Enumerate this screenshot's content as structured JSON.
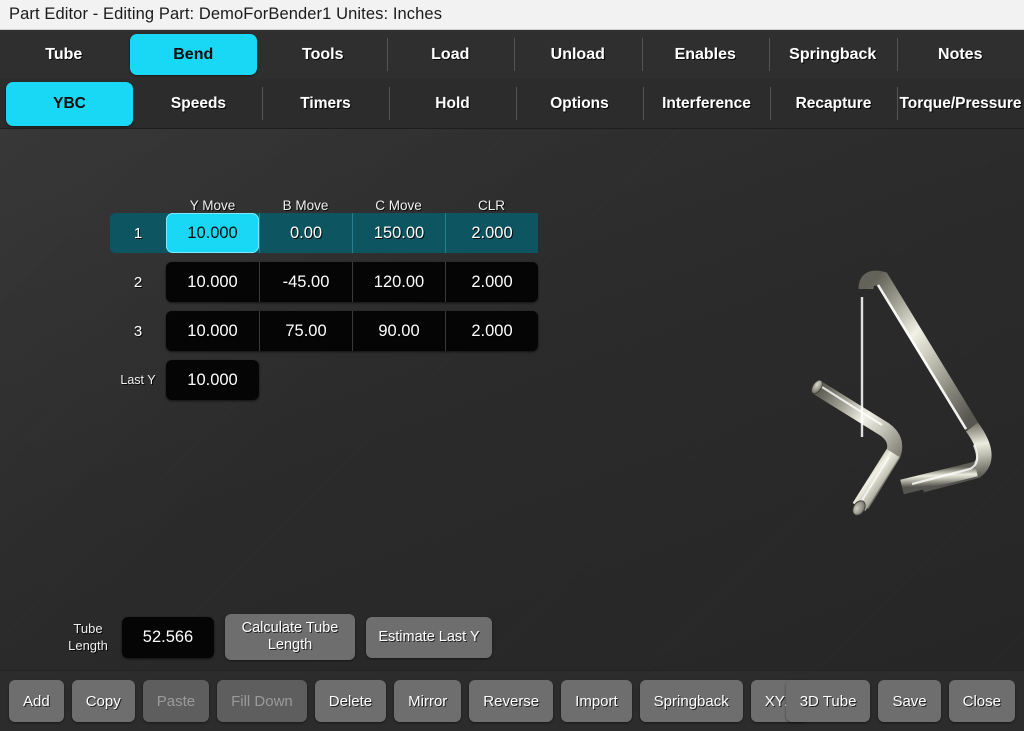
{
  "window": {
    "title": "Part Editor - Editing Part: DemoForBender1  Unites: Inches"
  },
  "tabs_primary": [
    {
      "label": "Tube",
      "active": false
    },
    {
      "label": "Bend",
      "active": true
    },
    {
      "label": "Tools",
      "active": false
    },
    {
      "label": "Load",
      "active": false
    },
    {
      "label": "Unload",
      "active": false
    },
    {
      "label": "Enables",
      "active": false
    },
    {
      "label": "Springback",
      "active": false
    },
    {
      "label": "Notes",
      "active": false
    }
  ],
  "tabs_secondary": [
    {
      "label": "YBC",
      "active": true
    },
    {
      "label": "Speeds",
      "active": false
    },
    {
      "label": "Timers",
      "active": false
    },
    {
      "label": "Hold",
      "active": false
    },
    {
      "label": "Options",
      "active": false
    },
    {
      "label": "Interference",
      "active": false
    },
    {
      "label": "Recapture",
      "active": false
    },
    {
      "label": "Torque/Pressure",
      "active": false
    }
  ],
  "table": {
    "columns": [
      "Y Move",
      "B Move",
      "C Move",
      "CLR"
    ],
    "rows": [
      {
        "num": "1",
        "values": [
          "10.000",
          "0.00",
          "150.00",
          "2.000"
        ],
        "selected": true,
        "editing_col": 0
      },
      {
        "num": "2",
        "values": [
          "10.000",
          "-45.00",
          "120.00",
          "2.000"
        ],
        "selected": false,
        "editing_col": -1
      },
      {
        "num": "3",
        "values": [
          "10.000",
          "75.00",
          "90.00",
          "2.000"
        ],
        "selected": false,
        "editing_col": -1
      }
    ],
    "last_y": {
      "label": "Last Y",
      "value": "10.000"
    }
  },
  "tube_length": {
    "label": "Tube\nLength",
    "label_line1": "Tube",
    "label_line2": "Length",
    "value": "52.566",
    "calculate_label_line1": "Calculate Tube",
    "calculate_label_line2": "Length",
    "estimate_label": "Estimate Last Y"
  },
  "toolbar_left": [
    {
      "label": "Add",
      "disabled": false
    },
    {
      "label": "Copy",
      "disabled": false
    },
    {
      "label": "Paste",
      "disabled": true
    },
    {
      "label": "Fill Down",
      "disabled": true
    },
    {
      "label": "Delete",
      "disabled": false
    },
    {
      "label": "Mirror",
      "disabled": false
    },
    {
      "label": "Reverse",
      "disabled": false
    },
    {
      "label": "Import",
      "disabled": false
    },
    {
      "label": "Springback",
      "disabled": false
    },
    {
      "label": "XYZ",
      "disabled": false
    }
  ],
  "toolbar_right": [
    {
      "label": "3D Tube",
      "disabled": false
    },
    {
      "label": "Save",
      "disabled": false
    },
    {
      "label": "Close",
      "disabled": false
    }
  ],
  "viewport": {
    "model_name": "bent-tube-3d-preview"
  },
  "colors": {
    "accent_cyan": "#18d8f5",
    "row_select_teal": "#0d5561",
    "button_gray": "#6e6e6e",
    "panel_dark": "#2c2c2c",
    "cell_black": "#050505",
    "titlebar": "#f2f2f2"
  }
}
